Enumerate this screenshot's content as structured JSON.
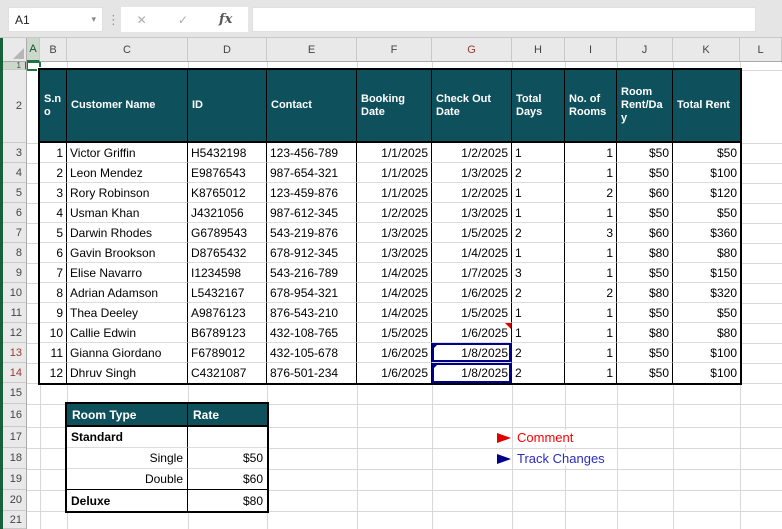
{
  "toolbar": {
    "name_box": "A1",
    "formula_value": "",
    "cancel_label": "✕",
    "enter_label": "✓",
    "fx_label": "fx"
  },
  "sheet": {
    "column_letters": [
      "A",
      "B",
      "C",
      "D",
      "E",
      "F",
      "G",
      "H",
      "I",
      "J",
      "K",
      "L"
    ],
    "row_count": 21,
    "selected_cell": "A1",
    "selected_column": "A",
    "selected_row": 1,
    "red_rows": [
      13,
      14
    ],
    "red_columns": [
      "G"
    ]
  },
  "booking_table": {
    "headers": [
      "S.no",
      "Customer Name",
      "ID",
      "Contact",
      "Booking Date",
      "Check Out Date",
      "Total Days",
      "No. of Rooms",
      "Room Rent/Day",
      "Total Rent"
    ],
    "rows": [
      [
        "1",
        "Victor Griffin",
        "H5432198",
        "123-456-789",
        "1/1/2025",
        "1/2/2025",
        "1",
        "1",
        "$50",
        "$50"
      ],
      [
        "2",
        "Leon Mendez",
        "E9876543",
        "987-654-321",
        "1/1/2025",
        "1/3/2025",
        "2",
        "1",
        "$50",
        "$100"
      ],
      [
        "3",
        "Rory Robinson",
        "K8765012",
        "123-459-876",
        "1/1/2025",
        "1/2/2025",
        "1",
        "2",
        "$60",
        "$120"
      ],
      [
        "4",
        "Usman Khan",
        "J4321056",
        "987-612-345",
        "1/2/2025",
        "1/3/2025",
        "1",
        "1",
        "$50",
        "$50"
      ],
      [
        "5",
        "Darwin Rhodes",
        "G6789543",
        "543-219-876",
        "1/3/2025",
        "1/5/2025",
        "2",
        "3",
        "$60",
        "$360"
      ],
      [
        "6",
        "Gavin Brookson",
        "D8765432",
        "678-912-345",
        "1/3/2025",
        "1/4/2025",
        "1",
        "1",
        "$80",
        "$80"
      ],
      [
        "7",
        "Elise Navarro",
        "I1234598",
        "543-216-789",
        "1/4/2025",
        "1/7/2025",
        "3",
        "1",
        "$50",
        "$150"
      ],
      [
        "8",
        "Adrian Adamson",
        "L5432167",
        "678-954-321",
        "1/4/2025",
        "1/6/2025",
        "2",
        "2",
        "$80",
        "$320"
      ],
      [
        "9",
        "Thea Deeley",
        "A9876123",
        "876-543-210",
        "1/4/2025",
        "1/5/2025",
        "1",
        "1",
        "$50",
        "$50"
      ],
      [
        "10",
        "Callie Edwin",
        "B6789123",
        "432-108-765",
        "1/5/2025",
        "1/6/2025",
        "1",
        "1",
        "$80",
        "$80"
      ],
      [
        "11",
        "Gianna Giordano",
        "F6789012",
        "432-105-678",
        "1/6/2025",
        "1/8/2025",
        "2",
        "1",
        "$50",
        "$100"
      ],
      [
        "12",
        "Dhruv Singh",
        "C4321087",
        "876-501-234",
        "1/6/2025",
        "1/8/2025",
        "2",
        "1",
        "$50",
        "$100"
      ]
    ]
  },
  "annotations": {
    "comment_cells": [
      "G12"
    ],
    "tracked_change_cells": [
      "G13",
      "G14"
    ]
  },
  "rate_table": {
    "headers": [
      "Room Type",
      "Rate"
    ],
    "rows": [
      {
        "label": "Standard",
        "rate": "",
        "group": true
      },
      {
        "label": "Single",
        "rate": "$50",
        "indent": true
      },
      {
        "label": "Double",
        "rate": "$60",
        "indent": true,
        "section_end": true
      },
      {
        "label": "Deluxe",
        "rate": "$80",
        "group": true
      }
    ]
  },
  "legend": [
    {
      "label": "Comment",
      "color": "#FF0000",
      "flag_color": "#E00000"
    },
    {
      "label": "Track Changes",
      "color": "#2B2BC0",
      "flag_color": "#00008B"
    }
  ],
  "colors": {
    "header_teal": "#0E505C",
    "selection_green": "#1F7245",
    "window_edge_green": "#17603A",
    "red_header_text": "#963C32",
    "comment_red": "#E00000",
    "tracked_blue": "#00008B",
    "gridline": "#D8D8D8"
  }
}
